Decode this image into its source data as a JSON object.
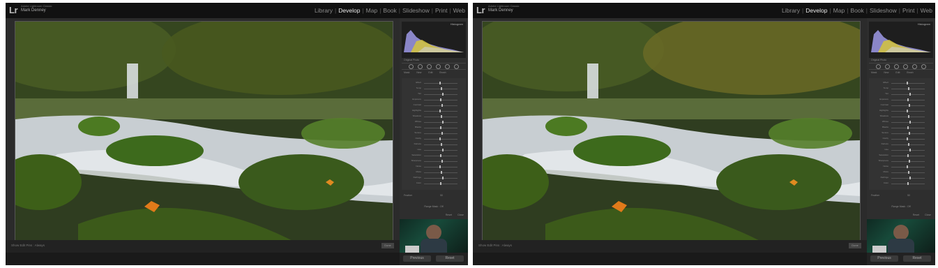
{
  "windows": [
    {
      "id": "left",
      "app_name": "Adobe Lightroom Classic",
      "user_name": "Mark Denney",
      "modules": [
        "Library",
        "Develop",
        "Map",
        "Book",
        "Slideshow",
        "Print",
        "Web"
      ],
      "active_module": "Develop",
      "histogram_label": "Histogram",
      "original_photo_label": "Original Photo",
      "mask_tabs": [
        "Mask",
        "New",
        "Edit",
        "Brush"
      ],
      "slider_labels": [
        "Effect",
        "Temp",
        "Tint",
        "Exposure",
        "Contrast",
        "Highlights",
        "Shadows",
        "Whites",
        "Blacks",
        "Texture",
        "Clarity",
        "Dehaze",
        "Hue",
        "Saturation",
        "Sharpness",
        "Noise",
        "Moire",
        "Defringe",
        "Color"
      ],
      "feather_label": "Feather",
      "feather_value": "50",
      "range_mask_label": "Range Mask : Off",
      "reset_label": "Reset",
      "close_label": "Close",
      "toolbar_label": "Show Edit Pins : Always",
      "toolbar_done": "Done",
      "prev_button": "Previous",
      "reset_button": "Reset"
    },
    {
      "id": "right",
      "app_name": "Adobe Lightroom Classic",
      "user_name": "Mark Denney",
      "modules": [
        "Library",
        "Develop",
        "Map",
        "Book",
        "Slideshow",
        "Print",
        "Web"
      ],
      "active_module": "Develop",
      "histogram_label": "Histogram",
      "original_photo_label": "Original Photo",
      "mask_tabs": [
        "Mask",
        "New",
        "Edit",
        "Brush"
      ],
      "slider_labels": [
        "Effect",
        "Temp",
        "Tint",
        "Exposure",
        "Contrast",
        "Highlights",
        "Shadows",
        "Whites",
        "Blacks",
        "Texture",
        "Clarity",
        "Dehaze",
        "Hue",
        "Saturation",
        "Sharpness",
        "Noise",
        "Moire",
        "Defringe",
        "Color"
      ],
      "feather_label": "Feather",
      "feather_value": "50",
      "range_mask_label": "Range Mask : Off",
      "reset_label": "Reset",
      "close_label": "Close",
      "toolbar_label": "Show Edit Pins : Always",
      "toolbar_done": "Done",
      "prev_button": "Previous",
      "reset_button": "Reset"
    }
  ],
  "colors": {
    "app_bg": "#1a1a1a",
    "panel_bg": "#2e2e2e",
    "active_module": "#e6e6e6",
    "inactive_module": "#8a8a8a"
  }
}
